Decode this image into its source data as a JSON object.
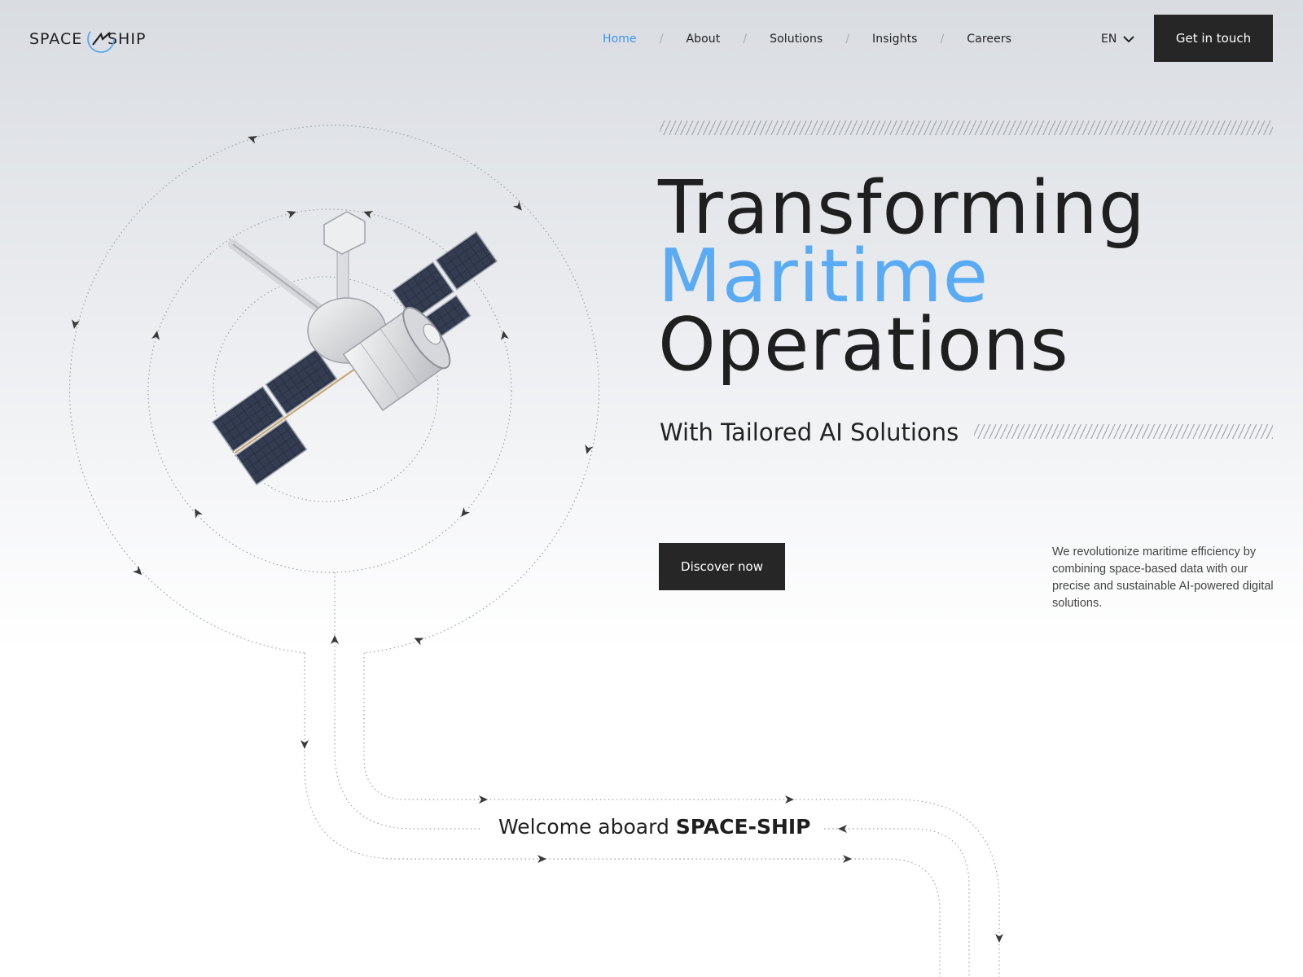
{
  "brand": {
    "logo_text": "SPACE-SHIP"
  },
  "nav": {
    "items": [
      {
        "label": "Home",
        "active": true
      },
      {
        "label": "About",
        "active": false
      },
      {
        "label": "Solutions",
        "active": false
      },
      {
        "label": "Insights",
        "active": false
      },
      {
        "label": "Careers",
        "active": false
      }
    ],
    "separator": "/"
  },
  "language": {
    "selected": "EN"
  },
  "header": {
    "cta_label": "Get in touch"
  },
  "hero": {
    "headline_line1": "Transforming",
    "headline_line2": "Maritime",
    "headline_line3": "Operations",
    "subheadline": "With Tailored AI Solutions",
    "cta_label": "Discover now",
    "description": "We revolutionize maritime efficiency by combining space-based data with our precise and sustainable AI-powered digital solutions."
  },
  "welcome": {
    "prefix": "Welcome aboard",
    "brand": "SPACE-SHIP"
  },
  "colors": {
    "accent": "#5aabf5",
    "nav_active": "#3d96f0",
    "button_bg": "#262626",
    "text": "#1f1f1f"
  }
}
